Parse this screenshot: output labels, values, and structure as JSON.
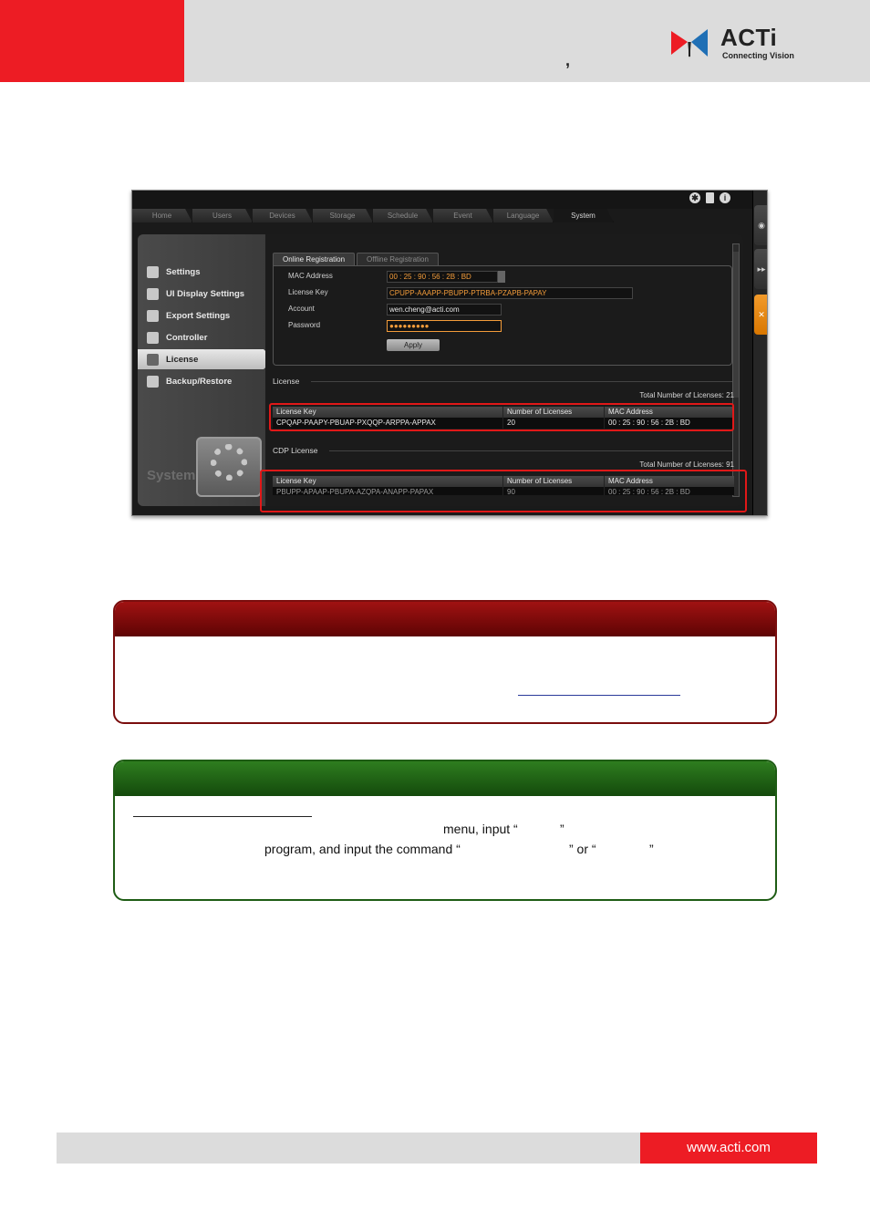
{
  "header": {
    "comma": ",",
    "logo_text": "ACTi",
    "logo_sub": "Connecting Vision"
  },
  "app": {
    "nav_tabs": [
      "Home",
      "Users",
      "Devices",
      "Storage",
      "Schedule",
      "Event",
      "Language",
      "System"
    ],
    "active_nav_tab": "System",
    "top_icons": [
      "gear-icon",
      "document-icon",
      "info-icon"
    ],
    "sidebar": {
      "items": [
        {
          "label": "Settings",
          "icon": "gear-icon"
        },
        {
          "label": "UI Display Settings",
          "icon": "display-icon"
        },
        {
          "label": "Export Settings",
          "icon": "export-icon"
        },
        {
          "label": "Controller",
          "icon": "joystick-icon"
        },
        {
          "label": "License",
          "icon": "key-icon"
        },
        {
          "label": "Backup/Restore",
          "icon": "folder-icon"
        }
      ],
      "active_item": "License",
      "section_title": "System"
    },
    "sub_tabs": [
      "Online Registration",
      "Offline Registration"
    ],
    "form": {
      "mac_label": "MAC Address",
      "mac_value": "00 : 25 : 90 : 56 : 2B : BD",
      "license_key_label": "License Key",
      "license_key_value": "CPUPP-AAAPP-PBUPP-PTRBA-PZAPB-PAPAY",
      "account_label": "Account",
      "account_value": "wen.cheng@acti.com",
      "password_label": "Password",
      "password_value": "●●●●●●●●●",
      "apply_label": "Apply"
    },
    "license_section": {
      "title": "License",
      "total": "Total Number of Licenses: 21",
      "columns": [
        "License Key",
        "Number of Licenses",
        "MAC Address"
      ],
      "rows": [
        [
          "CPQAP-PAAPY-PBUAP-PXQQP-ARPPA-APPAX",
          "20",
          "00 : 25 : 90 : 56 : 2B : BD"
        ]
      ]
    },
    "cdp_section": {
      "title": "CDP License",
      "total": "Total Number of Licenses: 91",
      "columns": [
        "License Key",
        "Number of Licenses",
        "MAC Address"
      ],
      "rows": [
        [
          "PBUPP-APAAP-PBUPA-AZQPA-ANAPP-PAPAX",
          "90",
          "00 : 25 : 90 : 56 : 2B : BD"
        ]
      ]
    }
  },
  "note_callout": {},
  "tip_callout": {
    "line1_a": "menu, input “",
    "line1_b": "”",
    "line2_a": "program, and input the command “",
    "line2_b": "” or “",
    "line2_c": "”"
  },
  "footer": {
    "url": "www.acti.com"
  },
  "colors": {
    "brand_red": "#ed1c24",
    "note_red": "#7a0d0d",
    "tip_green": "#1e5c14",
    "accent_orange": "#f39c3a"
  }
}
